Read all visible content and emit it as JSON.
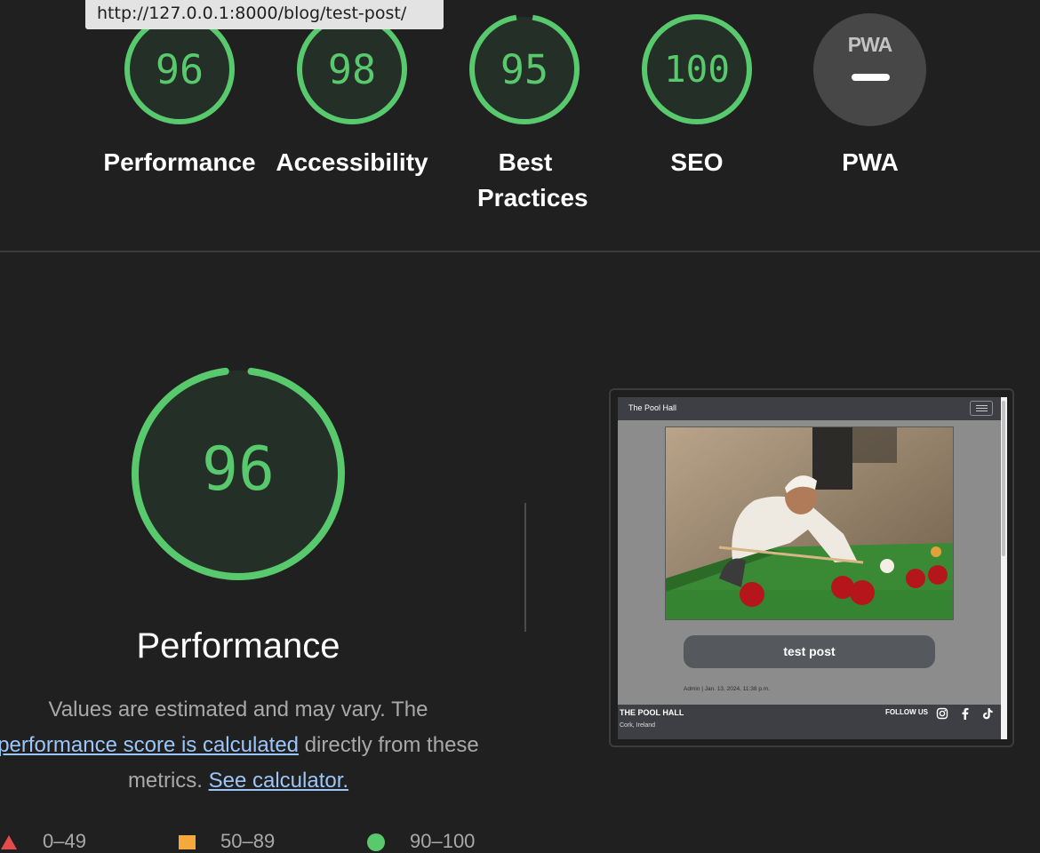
{
  "tooltip": {
    "url": "http://127.0.0.1:8000/blog/test-post/"
  },
  "colors": {
    "good": "#59c96e",
    "average": "#f5a93a",
    "fail": "#e44b4b",
    "link": "#9bc6f7"
  },
  "gauges": [
    {
      "label": "Performance",
      "score": "96",
      "value": 96
    },
    {
      "label": "Accessibility",
      "score": "98",
      "value": 98
    },
    {
      "label": "Best Practices",
      "score": "95",
      "value": 95
    },
    {
      "label": "SEO",
      "score": "100",
      "value": 100
    }
  ],
  "pwa": {
    "label": "PWA",
    "logo": "PWA",
    "icon": "pwa-icon"
  },
  "main": {
    "score": "96",
    "value": 96,
    "title": "Performance",
    "desc_text_1": "Values are estimated and may vary. The",
    "desc_link_1": "performance score is calculated",
    "desc_text_2": "directly from these metrics.",
    "desc_link_2": "See calculator."
  },
  "legend": [
    {
      "range": "0–49",
      "icon": "triangle-icon"
    },
    {
      "range": "50–89",
      "icon": "square-icon"
    },
    {
      "range": "90–100",
      "icon": "circle-icon"
    }
  ],
  "thumbnail": {
    "brand": "The Pool Hall",
    "menu_icon": "hamburger-icon",
    "photo": "snooker-player-photo",
    "post_title": "test post",
    "meta": "Admin | Jan. 13, 2024, 11:38 p.m.",
    "footer_name": "THE POOL HALL",
    "footer_location": "Cork, Ireland",
    "follow_label": "FOLLOW US",
    "social_icons": [
      "instagram-icon",
      "facebook-icon",
      "tiktok-icon"
    ]
  }
}
